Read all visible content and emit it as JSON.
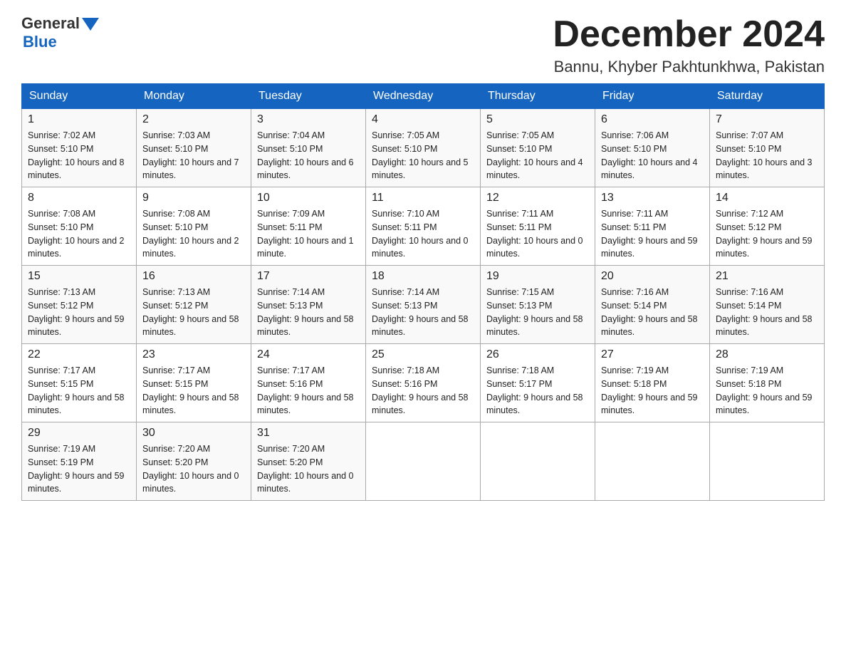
{
  "logo": {
    "general": "General",
    "blue": "Blue"
  },
  "title": "December 2024",
  "location": "Bannu, Khyber Pakhtunkhwa, Pakistan",
  "headers": [
    "Sunday",
    "Monday",
    "Tuesday",
    "Wednesday",
    "Thursday",
    "Friday",
    "Saturday"
  ],
  "weeks": [
    [
      {
        "day": "1",
        "sunrise": "7:02 AM",
        "sunset": "5:10 PM",
        "daylight": "10 hours and 8 minutes."
      },
      {
        "day": "2",
        "sunrise": "7:03 AM",
        "sunset": "5:10 PM",
        "daylight": "10 hours and 7 minutes."
      },
      {
        "day": "3",
        "sunrise": "7:04 AM",
        "sunset": "5:10 PM",
        "daylight": "10 hours and 6 minutes."
      },
      {
        "day": "4",
        "sunrise": "7:05 AM",
        "sunset": "5:10 PM",
        "daylight": "10 hours and 5 minutes."
      },
      {
        "day": "5",
        "sunrise": "7:05 AM",
        "sunset": "5:10 PM",
        "daylight": "10 hours and 4 minutes."
      },
      {
        "day": "6",
        "sunrise": "7:06 AM",
        "sunset": "5:10 PM",
        "daylight": "10 hours and 4 minutes."
      },
      {
        "day": "7",
        "sunrise": "7:07 AM",
        "sunset": "5:10 PM",
        "daylight": "10 hours and 3 minutes."
      }
    ],
    [
      {
        "day": "8",
        "sunrise": "7:08 AM",
        "sunset": "5:10 PM",
        "daylight": "10 hours and 2 minutes."
      },
      {
        "day": "9",
        "sunrise": "7:08 AM",
        "sunset": "5:10 PM",
        "daylight": "10 hours and 2 minutes."
      },
      {
        "day": "10",
        "sunrise": "7:09 AM",
        "sunset": "5:11 PM",
        "daylight": "10 hours and 1 minute."
      },
      {
        "day": "11",
        "sunrise": "7:10 AM",
        "sunset": "5:11 PM",
        "daylight": "10 hours and 0 minutes."
      },
      {
        "day": "12",
        "sunrise": "7:11 AM",
        "sunset": "5:11 PM",
        "daylight": "10 hours and 0 minutes."
      },
      {
        "day": "13",
        "sunrise": "7:11 AM",
        "sunset": "5:11 PM",
        "daylight": "9 hours and 59 minutes."
      },
      {
        "day": "14",
        "sunrise": "7:12 AM",
        "sunset": "5:12 PM",
        "daylight": "9 hours and 59 minutes."
      }
    ],
    [
      {
        "day": "15",
        "sunrise": "7:13 AM",
        "sunset": "5:12 PM",
        "daylight": "9 hours and 59 minutes."
      },
      {
        "day": "16",
        "sunrise": "7:13 AM",
        "sunset": "5:12 PM",
        "daylight": "9 hours and 58 minutes."
      },
      {
        "day": "17",
        "sunrise": "7:14 AM",
        "sunset": "5:13 PM",
        "daylight": "9 hours and 58 minutes."
      },
      {
        "day": "18",
        "sunrise": "7:14 AM",
        "sunset": "5:13 PM",
        "daylight": "9 hours and 58 minutes."
      },
      {
        "day": "19",
        "sunrise": "7:15 AM",
        "sunset": "5:13 PM",
        "daylight": "9 hours and 58 minutes."
      },
      {
        "day": "20",
        "sunrise": "7:16 AM",
        "sunset": "5:14 PM",
        "daylight": "9 hours and 58 minutes."
      },
      {
        "day": "21",
        "sunrise": "7:16 AM",
        "sunset": "5:14 PM",
        "daylight": "9 hours and 58 minutes."
      }
    ],
    [
      {
        "day": "22",
        "sunrise": "7:17 AM",
        "sunset": "5:15 PM",
        "daylight": "9 hours and 58 minutes."
      },
      {
        "day": "23",
        "sunrise": "7:17 AM",
        "sunset": "5:15 PM",
        "daylight": "9 hours and 58 minutes."
      },
      {
        "day": "24",
        "sunrise": "7:17 AM",
        "sunset": "5:16 PM",
        "daylight": "9 hours and 58 minutes."
      },
      {
        "day": "25",
        "sunrise": "7:18 AM",
        "sunset": "5:16 PM",
        "daylight": "9 hours and 58 minutes."
      },
      {
        "day": "26",
        "sunrise": "7:18 AM",
        "sunset": "5:17 PM",
        "daylight": "9 hours and 58 minutes."
      },
      {
        "day": "27",
        "sunrise": "7:19 AM",
        "sunset": "5:18 PM",
        "daylight": "9 hours and 59 minutes."
      },
      {
        "day": "28",
        "sunrise": "7:19 AM",
        "sunset": "5:18 PM",
        "daylight": "9 hours and 59 minutes."
      }
    ],
    [
      {
        "day": "29",
        "sunrise": "7:19 AM",
        "sunset": "5:19 PM",
        "daylight": "9 hours and 59 minutes."
      },
      {
        "day": "30",
        "sunrise": "7:20 AM",
        "sunset": "5:20 PM",
        "daylight": "10 hours and 0 minutes."
      },
      {
        "day": "31",
        "sunrise": "7:20 AM",
        "sunset": "5:20 PM",
        "daylight": "10 hours and 0 minutes."
      },
      null,
      null,
      null,
      null
    ]
  ]
}
